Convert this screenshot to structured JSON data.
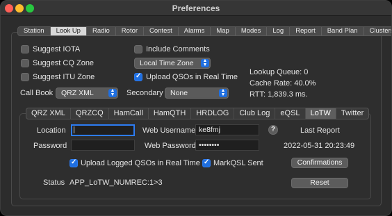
{
  "window": {
    "title": "Preferences"
  },
  "tabs": [
    "Station",
    "Look Up",
    "Radio",
    "Rotor",
    "Contest",
    "Alarms",
    "Map",
    "Modes",
    "Log",
    "Report",
    "Band Plan",
    "Clusters"
  ],
  "active_tab": "Look Up",
  "options": {
    "suggest_iota": {
      "label": "Suggest IOTA",
      "checked": false
    },
    "suggest_cq": {
      "label": "Suggest CQ Zone",
      "checked": false
    },
    "suggest_itu": {
      "label": "Suggest ITU Zone",
      "checked": false
    },
    "include_comments": {
      "label": "Include Comments",
      "checked": false
    },
    "time_zone": {
      "value": "Local Time Zone"
    },
    "upload_realtime": {
      "label": "Upload QSOs in Real Time",
      "checked": true
    },
    "call_book": {
      "label": "Call Book",
      "value": "QRZ XML"
    },
    "secondary": {
      "label": "Secondary",
      "value": "None"
    }
  },
  "stats": {
    "queue": "Lookup Queue: 0",
    "cache": "Cache Rate: 40.0%",
    "rtt": "RTT: 1,839.3 ms."
  },
  "subtabs": [
    "QRZ XML",
    "QRZCQ",
    "HamCall",
    "HamQTH",
    "HRDLOG",
    "Club Log",
    "eQSL",
    "LoTW",
    "Twitter"
  ],
  "active_subtab": "LoTW",
  "lotw": {
    "location_label": "Location",
    "location_value": "",
    "password_label": "Password",
    "password_value": "",
    "web_username_label": "Web Username",
    "web_username_value": "ke8fmj",
    "web_password_label": "Web Password",
    "web_password_value": "••••••••",
    "help_icon": "?",
    "last_report_label": "Last Report",
    "last_report_value": "2022-05-31 20:23:49",
    "upload_logged_label": "Upload Logged QSOs in Real Time",
    "upload_logged_checked": true,
    "markqsl_label": "MarkQSL Sent",
    "markqsl_checked": true,
    "confirmations_button": "Confirmations",
    "status_label": "Status",
    "status_value": "APP_LoTW_NUMREC:1>3",
    "reset_button": "Reset"
  },
  "colors": {
    "accent": "#1f6fe0",
    "window_bg": "#2c2c2c",
    "focus_ring": "#2d7cf3"
  }
}
